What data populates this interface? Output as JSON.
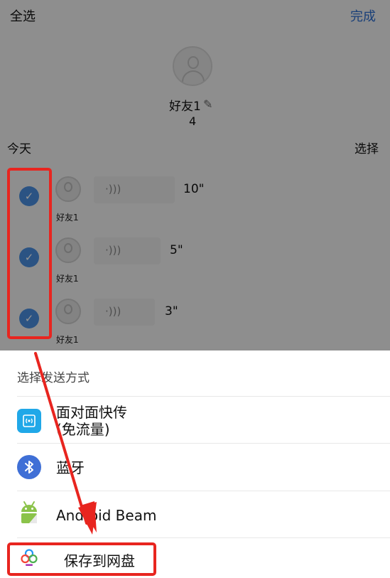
{
  "header": {
    "select_all": "全选",
    "done": "完成"
  },
  "profile": {
    "name": "好友1",
    "count": "4",
    "avatar_icon": "default-avatar-icon",
    "edit_icon": "pencil-icon"
  },
  "section": {
    "date": "今天",
    "select": "选择"
  },
  "messages": [
    {
      "sender": "好友1",
      "duration": "10\"",
      "checked": true,
      "icon": "voice-icon"
    },
    {
      "sender": "好友1",
      "duration": "5\"",
      "checked": true,
      "icon": "voice-icon"
    },
    {
      "sender": "好友1",
      "duration": "3\"",
      "checked": true,
      "icon": "voice-icon"
    }
  ],
  "check_glyph": "✓",
  "voice_glyph": "·)))",
  "sheet": {
    "title": "选择发送方式",
    "options": [
      {
        "label": "面对面快传",
        "sublabel": "(免流量)",
        "icon": "face-to-face-transfer-icon"
      },
      {
        "label": "蓝牙",
        "icon": "bluetooth-icon"
      },
      {
        "label": "Android Beam",
        "icon": "android-icon"
      },
      {
        "label": "保存到网盘",
        "icon": "cloud-drive-icon"
      }
    ]
  },
  "colors": {
    "accent": "#2d6fd0",
    "check": "#4a90e2",
    "highlight": "#e8251f",
    "wifi_icon_bg": "#20a8e8",
    "bluetooth_bg": "#3f6fd6",
    "android_green": "#8bc34a"
  }
}
